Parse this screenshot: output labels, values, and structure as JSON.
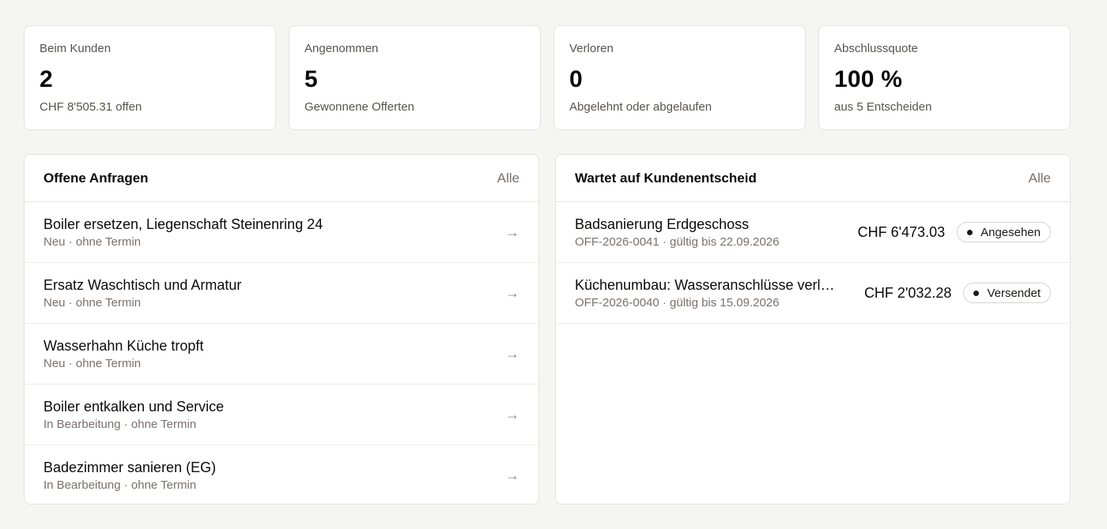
{
  "stats": [
    {
      "label": "Beim Kunden",
      "value": "2",
      "sub": "CHF 8'505.31 offen"
    },
    {
      "label": "Angenommen",
      "value": "5",
      "sub": "Gewonnene Offerten"
    },
    {
      "label": "Verloren",
      "value": "0",
      "sub": "Abgelehnt oder abgelaufen"
    },
    {
      "label": "Abschlussquote",
      "value": "100 %",
      "sub": "aus 5 Entscheiden"
    }
  ],
  "requests": {
    "title": "Offene Anfragen",
    "all_label": "Alle",
    "arrow": "→",
    "items": [
      {
        "title": "Boiler ersetzen, Liegenschaft Steinenring 24",
        "sub": "Neu · ohne Termin"
      },
      {
        "title": "Ersatz Waschtisch und Armatur",
        "sub": "Neu · ohne Termin"
      },
      {
        "title": "Wasserhahn Küche tropft",
        "sub": "Neu · ohne Termin"
      },
      {
        "title": "Boiler entkalken und Service",
        "sub": "In Bearbeitung · ohne Termin"
      },
      {
        "title": "Badezimmer sanieren (EG)",
        "sub": "In Bearbeitung · ohne Termin"
      }
    ]
  },
  "offers": {
    "title": "Wartet auf Kundenentscheid",
    "all_label": "Alle",
    "items": [
      {
        "title": "Badsanierung Erdgeschoss",
        "sub": "OFF-2026-0041 · gültig bis 22.09.2026",
        "amount": "CHF 6'473.03",
        "status": "Angesehen"
      },
      {
        "title": "Küchenumbau: Wasseranschlüsse verlegen",
        "sub": "OFF-2026-0040 · gültig bis 15.09.2026",
        "amount": "CHF 2'032.28",
        "status": "Versendet"
      }
    ]
  }
}
